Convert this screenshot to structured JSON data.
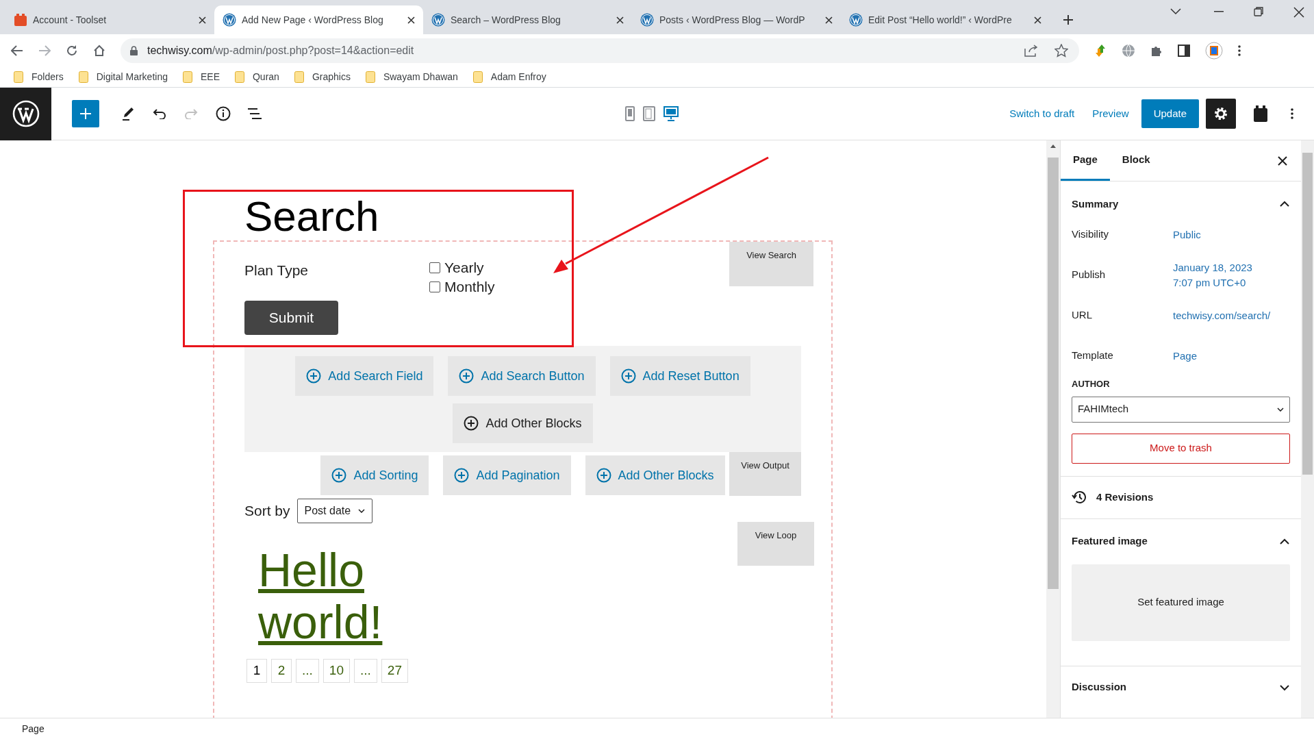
{
  "browser": {
    "tabs": [
      {
        "title": "Account - Toolset",
        "kind": "toolset",
        "selected": false
      },
      {
        "title": "Add New Page ‹ WordPress Blog",
        "kind": "wordpress",
        "selected": true
      },
      {
        "title": "Search – WordPress Blog",
        "kind": "wordpress",
        "selected": false
      },
      {
        "title": "Posts ‹ WordPress Blog — WordP",
        "kind": "wordpress",
        "selected": false
      },
      {
        "title": "Edit Post “Hello world!” ‹ WordPre",
        "kind": "wordpress",
        "selected": false
      }
    ],
    "url_host": "techwisy.com",
    "url_path": "/wp-admin/post.php?post=14&action=edit",
    "bookmarks": [
      "Folders",
      "Digital Marketing",
      "EEE",
      "Quran",
      "Graphics",
      "Swayam Dhawan",
      "Adam Enfroy"
    ]
  },
  "editor_toolbar": {
    "preview_devices": [
      {
        "kind": "mobile",
        "selected": false
      },
      {
        "kind": "tablet",
        "selected": false
      },
      {
        "kind": "desktop",
        "selected": true
      }
    ],
    "switch_to_draft": "Switch to draft",
    "preview": "Preview",
    "update": "Update"
  },
  "content": {
    "title": "Search",
    "form": {
      "label": "Plan Type",
      "options": [
        {
          "label": "Yearly",
          "checked": false
        },
        {
          "label": "Monthly",
          "checked": false
        }
      ],
      "submit": "Submit"
    },
    "view_search": "View Search",
    "search_blocks": [
      "Add Search Field",
      "Add Search Button",
      "Add Reset Button"
    ],
    "search_other": "Add Other Blocks",
    "output_blocks": [
      "Add Sorting",
      "Add Pagination",
      "Add Other Blocks"
    ],
    "view_output": "View Output",
    "sort_label": "Sort by",
    "sort_value": "Post date",
    "view_loop": "View Loop",
    "post_title": "Hello world!",
    "pagination": [
      {
        "label": "1",
        "current": true
      },
      {
        "label": "2",
        "current": false
      },
      {
        "label": "...",
        "current": false
      },
      {
        "label": "10",
        "current": false
      },
      {
        "label": "...",
        "current": false
      },
      {
        "label": "27",
        "current": false
      }
    ]
  },
  "sidebar": {
    "tabs": [
      {
        "label": "Page",
        "selected": true
      },
      {
        "label": "Block",
        "selected": false
      }
    ],
    "summary": {
      "heading": "Summary",
      "expanded": true,
      "rows": [
        {
          "label": "Visibility",
          "value": "Public"
        },
        {
          "label": "Publish",
          "value": "January 18, 2023\n7:07 pm UTC+0"
        },
        {
          "label": "URL",
          "value": "techwisy.com/search/"
        },
        {
          "label": "Template",
          "value": "Page"
        }
      ],
      "author_label": "AUTHOR",
      "author": "FAHIMtech",
      "trash": "Move to trash"
    },
    "revisions": "4 Revisions",
    "featured_image": {
      "heading": "Featured image",
      "expanded": true,
      "button": "Set featured image"
    },
    "discussion": {
      "heading": "Discussion",
      "expanded": false
    }
  },
  "status_bar": "Page"
}
